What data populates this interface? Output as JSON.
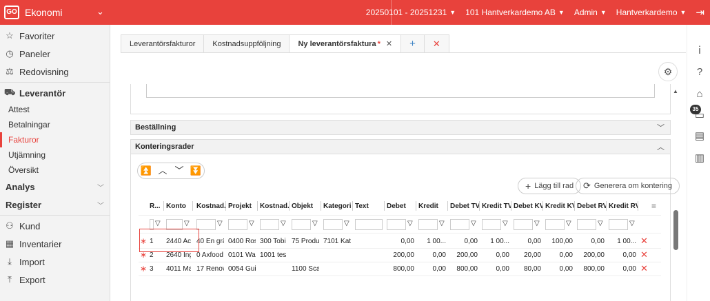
{
  "app": {
    "logo": "GO",
    "title": "Ekonomi"
  },
  "topnav": {
    "period": "20250101 - 20251231",
    "company": "101 Hantverkardemo AB",
    "role": "Admin",
    "user": "Hantverkardemo"
  },
  "sidebar": {
    "items": [
      {
        "label": "Favoriter",
        "icon": "star-icon"
      },
      {
        "label": "Paneler",
        "icon": "gauge-icon"
      },
      {
        "label": "Redovisning",
        "icon": "scale-icon"
      }
    ],
    "section": {
      "label": "Leverantör",
      "icon": "truck-icon"
    },
    "subitems": [
      "Attest",
      "Betalningar",
      "Fakturor",
      "Utjämning",
      "Översikt"
    ],
    "active_sub": "Fakturor",
    "groups": [
      "Analys",
      "Register"
    ],
    "bottom": [
      {
        "label": "Kund",
        "icon": "person-icon"
      },
      {
        "label": "Inventarier",
        "icon": "inventory-icon"
      },
      {
        "label": "Import",
        "icon": "import-icon"
      },
      {
        "label": "Export",
        "icon": "export-icon"
      }
    ]
  },
  "tabs": [
    {
      "label": "Leverantörsfakturor"
    },
    {
      "label": "Kostnadsuppföljning"
    },
    {
      "label": "Ny leverantörsfaktura",
      "modified_marker": "*"
    }
  ],
  "sections": {
    "bestallning": "Beställning",
    "konteringsrader": "Konteringsrader"
  },
  "buttons": {
    "add_row": "Lägg till rad",
    "regenerate": "Generera om kontering"
  },
  "grid": {
    "columns": [
      "R...",
      "Konto",
      "Kostnad...",
      "Projekt",
      "Kostnad...",
      "Objekt",
      "Kategori",
      "Text",
      "Debet",
      "Kredit",
      "Debet TV",
      "Kredit TV",
      "Debet KV",
      "Kredit KV",
      "Debet RV",
      "Kredit RV"
    ],
    "rows": [
      {
        "nr": "1",
        "konto": "2440 Acc",
        "kostnad1": "40 En grä",
        "projekt": "0400 Ros",
        "kostnad2": "300 Tobi",
        "objekt": "75 Produ",
        "kategori": "7101 Kat",
        "text": "",
        "debet": "0,00",
        "kredit": "1 00...",
        "debet_tv": "0,00",
        "kredit_tv": "1 00...",
        "debet_kv": "0,00",
        "kredit_kv": "100,00",
        "debet_rv": "0,00",
        "kredit_rv": "1 00..."
      },
      {
        "nr": "2",
        "konto": "2640 Ing",
        "kostnad1": "0 Axfood",
        "projekt": "0101 Wa",
        "kostnad2": "1001 tes",
        "objekt": "",
        "kategori": "",
        "text": "",
        "debet": "200,00",
        "kredit": "0,00",
        "debet_tv": "200,00",
        "kredit_tv": "0,00",
        "debet_kv": "20,00",
        "kredit_kv": "0,00",
        "debet_rv": "200,00",
        "kredit_rv": "0,00"
      },
      {
        "nr": "3",
        "konto": "4011 Ma",
        "kostnad1": "17 Renov",
        "projekt": "0054 Gui",
        "kostnad2": "",
        "objekt": "1100 Sca",
        "kategori": "",
        "text": "",
        "debet": "800,00",
        "kredit": "0,00",
        "debet_tv": "800,00",
        "kredit_tv": "0,00",
        "debet_kv": "80,00",
        "kredit_kv": "0,00",
        "debet_rv": "800,00",
        "kredit_rv": "0,00"
      }
    ]
  },
  "rightbar": {
    "badge": "35"
  },
  "colors": {
    "brand": "#e8423c",
    "accent": "#3b82c4"
  }
}
